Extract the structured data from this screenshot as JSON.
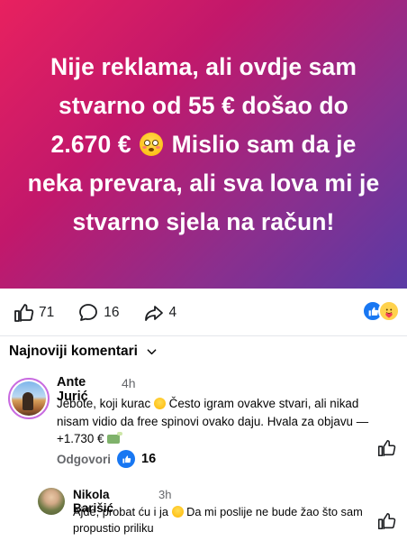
{
  "post": {
    "text_before_emoji": "Nije reklama, ali ovdje sam stvarno od 55 € došao do 2.670 €",
    "text_after_emoji": "Mislio sam da je neka prevara, ali sva lova mi je stvarno sjela na račun!",
    "emoji": "flushed-face"
  },
  "actions": {
    "likes": "71",
    "comments": "16",
    "shares": "4",
    "reactions": [
      "like",
      "care"
    ]
  },
  "comments_header": {
    "sort_label": "Najnoviji komentari"
  },
  "comments": [
    {
      "author": "Ante Jurić",
      "time": "4h",
      "text_part1": "Jebote, koji kurac",
      "text_part2": "Često igram ovakve stvari, ali nikad nisam vidio da free spinovi ovako daju. Hvala za objavu — +1.730 €",
      "reply_label": "Odgovori",
      "like_count": "16"
    },
    {
      "author": "Nikola Barišić",
      "time": "3h",
      "text_part1": "Ajde, probat ću i ja",
      "text_part2": "Da mi poslije ne bude žao što sam propustio priliku"
    }
  ],
  "colors": {
    "accent_blue": "#1877f2",
    "hero_gradient_start": "#e8215f",
    "hero_gradient_end": "#5a3aa5",
    "muted_text": "#65676b"
  }
}
